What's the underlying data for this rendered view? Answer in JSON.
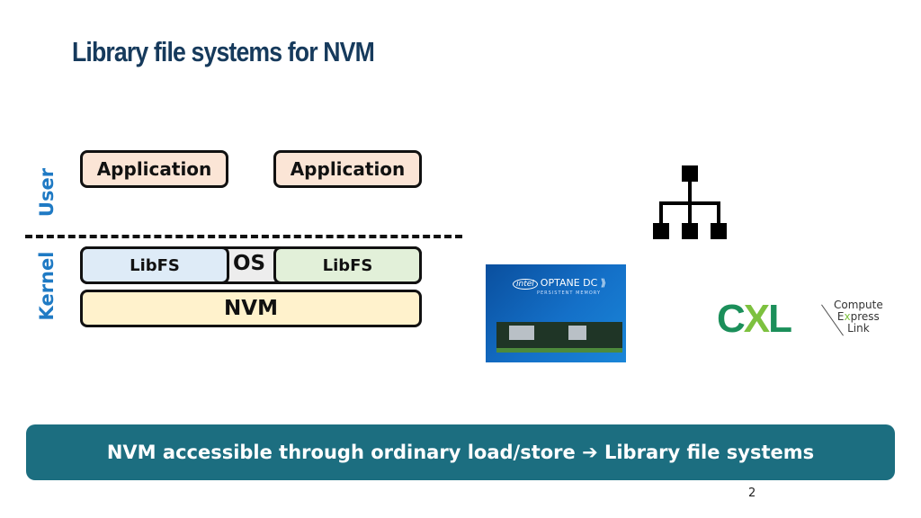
{
  "slide": {
    "title": "Library file systems for NVM",
    "page_number": "2"
  },
  "diagram": {
    "layers": {
      "user_label": "User",
      "kernel_label": "Kernel"
    },
    "applications": [
      {
        "label": "Application"
      },
      {
        "label": "Application"
      }
    ],
    "libfs_left": "LibFS",
    "os_label": "OS",
    "libfs_right": "LibFS",
    "nvm_label": "NVM",
    "colors": {
      "app_fill": "#fbe5d6",
      "libfs_left_fill": "#deebf7",
      "libfs_right_fill": "#e2f0d9",
      "os_fill": "#ededed",
      "nvm_fill": "#fff2cc",
      "layer_label": "#1f7ac4"
    }
  },
  "images": {
    "hierarchy_icon": "hierarchy-icon",
    "optane": {
      "brand": "intel",
      "product": "OPTANE DC",
      "subtitle": "PERSISTENT MEMORY"
    },
    "cxl": {
      "logo": "CXL",
      "line1": "Compute",
      "line2_pre": "E",
      "line2_x": "x",
      "line2_post": "press",
      "line3": "Link"
    }
  },
  "banner": {
    "text": "NVM accessible through ordinary load/store ➔ Library file systems",
    "color": "#1c6e80"
  }
}
